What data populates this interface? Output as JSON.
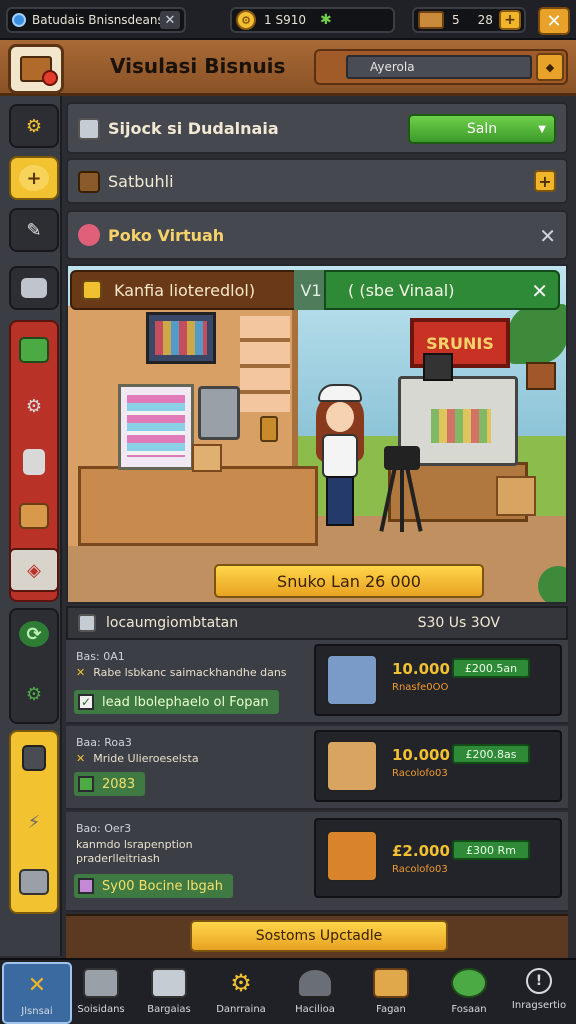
{
  "topbar": {
    "app_label": "Batudais Bnisnsdeans",
    "resource_value": "1 S910",
    "gold_value": "5",
    "gold_value2": "28"
  },
  "header": {
    "title": "Visulasi Bisnuis",
    "search_value": "Ayerola"
  },
  "panels": {
    "stock": {
      "title": "Sijock si Dudalnaia",
      "button_label": "Saln"
    },
    "section": {
      "title": "Satbuhli"
    },
    "virtual": {
      "title": "Poko Virtuah"
    }
  },
  "scene": {
    "badge_left": "Kanfia lioteredlol)",
    "badge_mid": "V1",
    "badge_right": "( (sbe Vinaal)",
    "sign_text": "SRUNIS",
    "price_label": "Snuko Lan 26 000"
  },
  "list": {
    "header_title": "locaumgiombtatan",
    "header_right": "S30 Us 3OV",
    "rows": [
      {
        "code": "Bas: 0A1",
        "desc": "Rabe lsbkanc saimackhandhe dans",
        "tag": "lead lbolephaelo ol Fopan",
        "price": "10.000",
        "sub": "Rnasfe0OO",
        "pill": "£200.5an"
      },
      {
        "code": "Baa: Roa3",
        "desc": "Mride Ulieroeselsta",
        "tag": "2083",
        "price": "10.000",
        "sub": "Racolofo03",
        "pill": "£200.8as"
      },
      {
        "code": "Bao: Oer3",
        "desc": "kanmdo lsrapenption praderlleitriash",
        "tag": "Sy00 Bocine lbgah",
        "price": "£2.000",
        "sub": "Racolofo03",
        "pill": "£300 Rm"
      }
    ]
  },
  "footer": {
    "button_label": "Sostoms Upctadle"
  },
  "bottomnav": {
    "items": [
      {
        "label": "Jlsnsai"
      },
      {
        "label": "Soisidans"
      },
      {
        "label": "Bargaias"
      },
      {
        "label": "Danrraina"
      },
      {
        "label": "Hacilioa"
      },
      {
        "label": "Fagan"
      },
      {
        "label": "Fosaan"
      },
      {
        "label": "Inragsertio"
      }
    ]
  },
  "colors": {
    "accent_yellow": "#f0b528",
    "accent_green": "#3c9a2a",
    "header_brown": "#a86a36",
    "active_blue": "#3a6aa0"
  }
}
